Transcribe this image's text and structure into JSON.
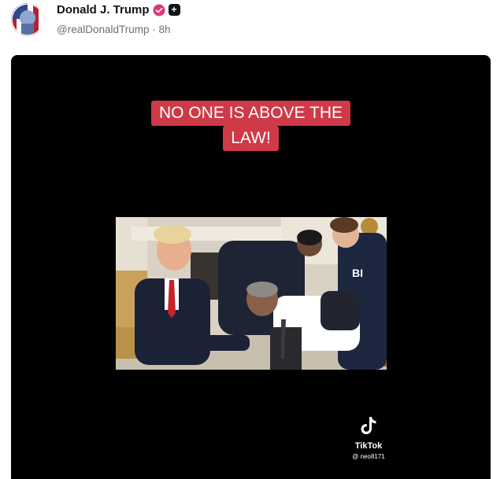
{
  "post": {
    "display_name": "Donald J. Trump",
    "handle": "@realDonaldTrump",
    "separator": "·",
    "time": "8h"
  },
  "media": {
    "caption_line1": "NO ONE IS ABOVE THE",
    "caption_line2": "LAW!",
    "jacket_text": "BI",
    "watermark_brand": "TikTok",
    "watermark_handle": "@ neo8171"
  },
  "colors": {
    "caption_bg": "#cf3a48",
    "verified": "#e0357a",
    "media_bg": "#000000"
  }
}
